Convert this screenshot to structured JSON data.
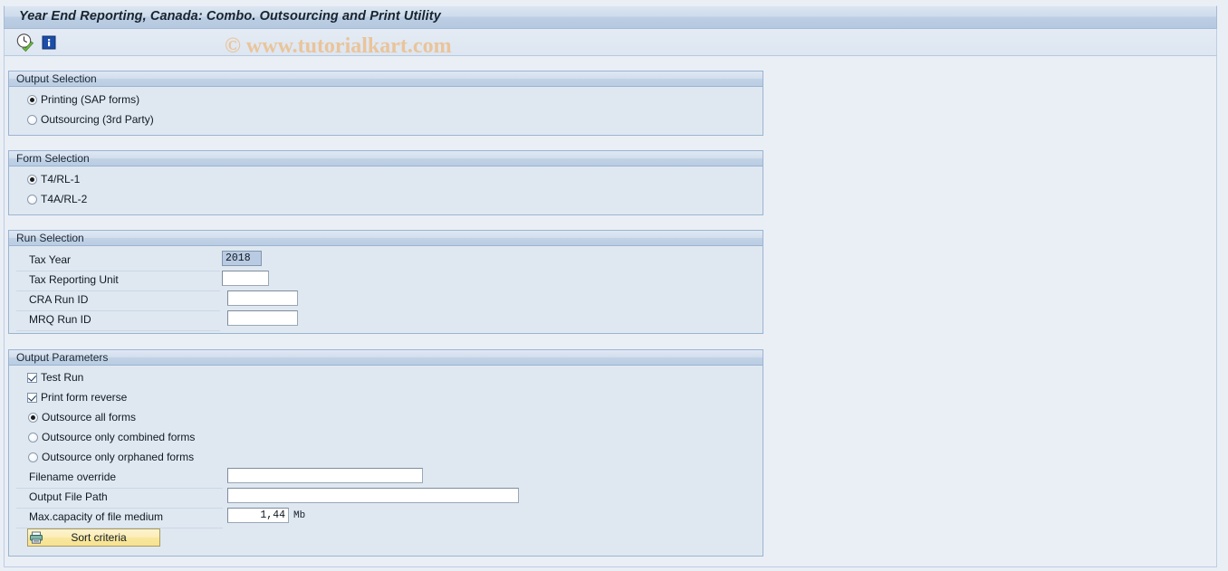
{
  "window": {
    "title": "Year End Reporting, Canada: Combo. Outsourcing and Print Utility"
  },
  "toolbar": {
    "execute_icon": "clock-check-execute-icon",
    "info_icon": "information-icon"
  },
  "watermark": {
    "text": "© www.tutorialkart.com",
    "color": "#eac49a"
  },
  "output_selection": {
    "header": "Output Selection",
    "options": [
      {
        "label": "Printing (SAP forms)",
        "selected": true
      },
      {
        "label": "Outsourcing (3rd Party)",
        "selected": false
      }
    ]
  },
  "form_selection": {
    "header": "Form Selection",
    "options": [
      {
        "label": "T4/RL-1",
        "selected": true
      },
      {
        "label": "T4A/RL-2",
        "selected": false
      }
    ]
  },
  "run_selection": {
    "header": "Run Selection",
    "fields": [
      {
        "label": "Tax Year",
        "value": "2018",
        "readonly": true
      },
      {
        "label": "Tax Reporting Unit",
        "value": "",
        "readonly": false
      },
      {
        "label": "CRA Run ID",
        "value": "",
        "readonly": false
      },
      {
        "label": "MRQ Run ID",
        "value": "",
        "readonly": false
      }
    ]
  },
  "output_parameters": {
    "header": "Output Parameters",
    "checkboxes": [
      {
        "label": "Test Run",
        "checked": true
      },
      {
        "label": "Print form reverse",
        "checked": true
      }
    ],
    "radios": [
      {
        "label": "Outsource all forms",
        "selected": true
      },
      {
        "label": "Outsource only combined forms",
        "selected": false
      },
      {
        "label": "Outsource only orphaned forms",
        "selected": false
      }
    ],
    "fields": [
      {
        "label": "Filename override",
        "value": ""
      },
      {
        "label": "Output File Path",
        "value": ""
      },
      {
        "label": "Max.capacity of file medium",
        "value": "1,44",
        "unit": "Mb"
      }
    ],
    "sort_button": {
      "label": "Sort criteria",
      "icon": "printer-sort-icon"
    }
  },
  "colors": {
    "page_background": "#eaeff6",
    "panel_background": "#dfe8f1",
    "panel_border": "#9bb4d1",
    "title_text": "#18242f",
    "button_yellow": "#fbeeb8"
  }
}
